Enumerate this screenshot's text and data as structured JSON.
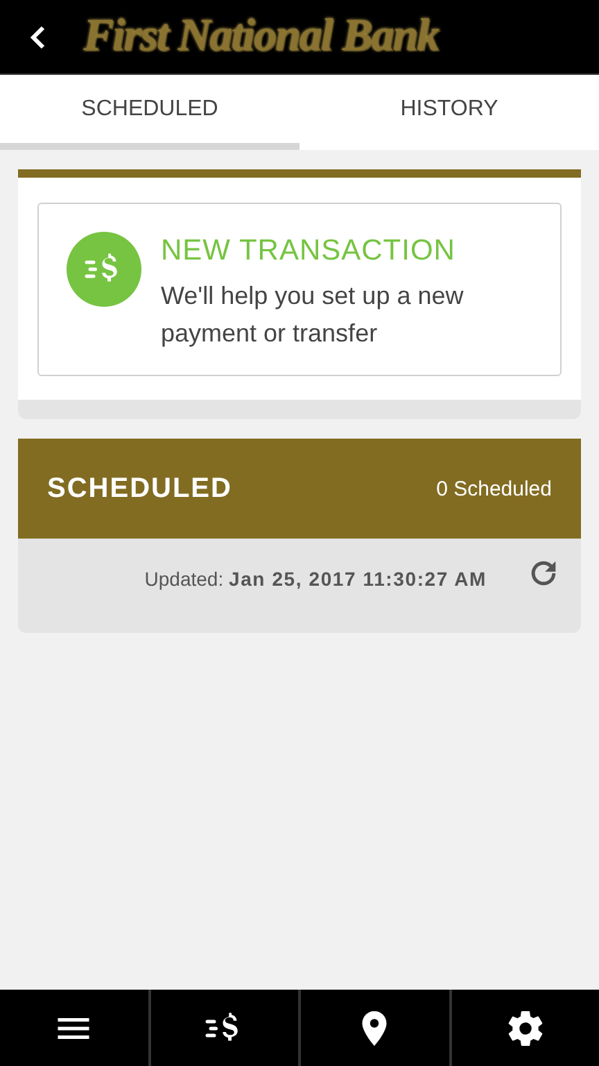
{
  "header": {
    "logo": "First National Bank"
  },
  "tabs": [
    {
      "label": "SCHEDULED",
      "selected": true
    },
    {
      "label": "HISTORY",
      "selected": false
    }
  ],
  "new_transaction": {
    "title": "NEW TRANSACTION",
    "description": "We'll help you set up a new payment or transfer"
  },
  "scheduled": {
    "title": "SCHEDULED",
    "count": "0 Scheduled",
    "updated": "Updated: **Jan 25, 2017 11:30:27 AM**"
  },
  "bottom_nav": [
    {
      "kind": "menu"
    },
    {
      "kind": "transfer"
    },
    {
      "kind": "location"
    },
    {
      "kind": "settings"
    }
  ]
}
